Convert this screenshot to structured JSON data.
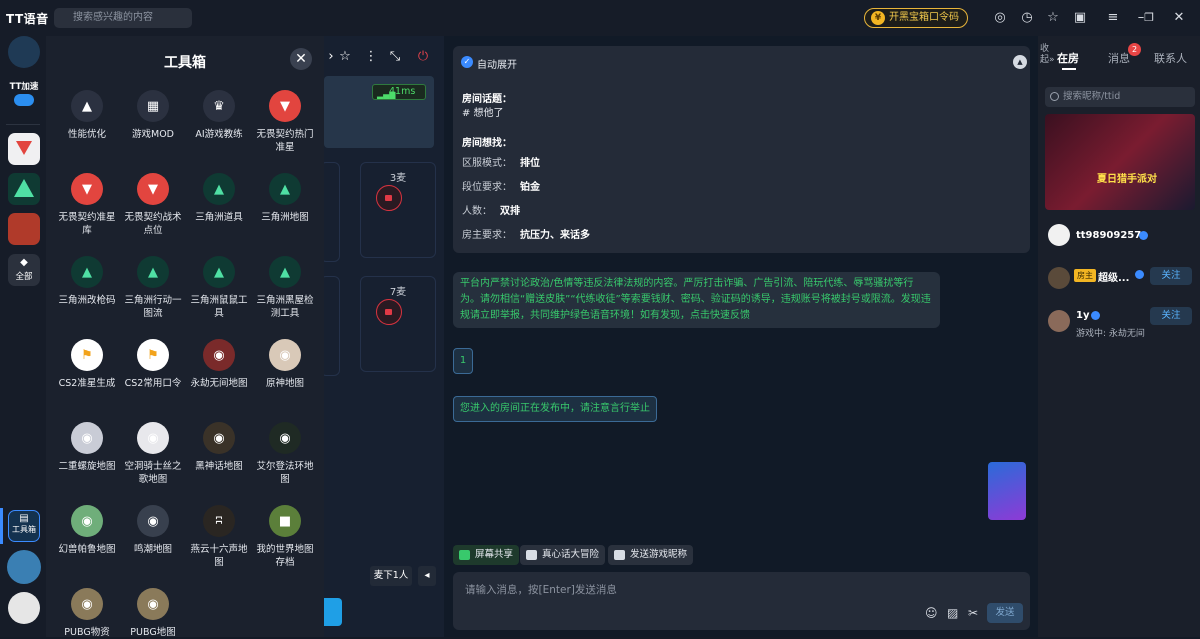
{
  "app": {
    "title": "TT语音"
  },
  "search": {
    "placeholder": "搜索感兴趣的内容"
  },
  "header": {
    "treasure_label": "开黑宝箱口令码"
  },
  "left_rail": {
    "tt_accel_label": "TT加速",
    "all_label": "全部",
    "toolbox_label": "工具箱"
  },
  "toolbox": {
    "title": "工具箱",
    "tools": [
      {
        "label": "性能优化",
        "icon": "rocket-icon",
        "color": "#2b3140"
      },
      {
        "label": "游戏MOD",
        "icon": "grid-icon",
        "color": "#2b3140"
      },
      {
        "label": "AI游戏教练",
        "icon": "ai-coach-icon",
        "color": "#2b3140"
      },
      {
        "label": "无畏契约热门准星",
        "icon": "valorant-icon",
        "color": "#e2453f"
      },
      {
        "label": "无畏契约准星库",
        "icon": "valorant-icon",
        "color": "#e2453f"
      },
      {
        "label": "无畏契约战术点位",
        "icon": "valorant-icon",
        "color": "#e2453f"
      },
      {
        "label": "三角洲道具",
        "icon": "delta-force-icon",
        "color": "#0f3a33"
      },
      {
        "label": "三角洲地图",
        "icon": "delta-force-icon",
        "color": "#0f3a33"
      },
      {
        "label": "三角洲改枪码",
        "icon": "delta-force-icon",
        "color": "#0f3a33"
      },
      {
        "label": "三角洲行动一图流",
        "icon": "delta-force-icon",
        "color": "#0f3a33"
      },
      {
        "label": "三角洲鼠鼠工具",
        "icon": "delta-force-icon",
        "color": "#0f3a33"
      },
      {
        "label": "三角洲黑屋检测工具",
        "icon": "delta-force-icon",
        "color": "#0f3a33"
      },
      {
        "label": "CS2准星生成",
        "icon": "cs2-icon",
        "color": "#ffffff"
      },
      {
        "label": "CS2常用口令",
        "icon": "cs2-icon",
        "color": "#ffffff"
      },
      {
        "label": "永劫无间地图",
        "icon": "naraka-icon",
        "color": "#7a2a2a"
      },
      {
        "label": "原神地图",
        "icon": "genshin-icon",
        "color": "#d9c9b8"
      },
      {
        "label": "二重螺旋地图",
        "icon": "duet-night-icon",
        "color": "#c9ccd6"
      },
      {
        "label": "空洞骑士丝之歌地图",
        "icon": "hollow-knight-icon",
        "color": "#e8e8ec"
      },
      {
        "label": "黑神话地图",
        "icon": "wukong-icon",
        "color": "#3a3228"
      },
      {
        "label": "艾尔登法环地图",
        "icon": "elden-ring-icon",
        "color": "#1f2a24"
      },
      {
        "label": "幻兽帕鲁地图",
        "icon": "palworld-icon",
        "color": "#6fae7a"
      },
      {
        "label": "鸣潮地图",
        "icon": "wuthering-waves-icon",
        "color": "#38404e"
      },
      {
        "label": "燕云十六声地图",
        "icon": "where-winds-meet-icon",
        "color": "#2a2622"
      },
      {
        "label": "我的世界地图存档",
        "icon": "minecraft-icon",
        "color": "#5b7f3a"
      },
      {
        "label": "PUBG物资",
        "icon": "pubg-icon",
        "color": "#8a7a5a"
      },
      {
        "label": "PUBG地图",
        "icon": "pubg-icon",
        "color": "#8a7a5a"
      }
    ]
  },
  "room": {
    "ping": "41ms",
    "slot_a": "3麦",
    "slot_b": "7麦",
    "mic_down": "麦下1人"
  },
  "info_card": {
    "auto_expand": "自动展开",
    "topic_label": "房间话题：",
    "topic_value": "# 想他了",
    "wants_label": "房间想找：",
    "rows": [
      {
        "k": "区服模式：",
        "v": "排位"
      },
      {
        "k": "段位要求：",
        "v": "铂金"
      },
      {
        "k": "人数：",
        "v": "双排"
      },
      {
        "k": "房主要求：",
        "v": "抗压力、来话多"
      }
    ]
  },
  "messages": {
    "warning": "平台内严禁讨论政治/色情等违反法律法规的内容。严厉打击诈骗、广告引流、陪玩代练、辱骂骚扰等行为。请勿相信“赠送皮肤”“代练收徒”等索要钱财、密码、验证码的诱导，违规账号将被封号或限流。发现违规请立即举报，共同维护绿色语音环境！如有发现，点击快速反馈",
    "user_msg": "1",
    "publish_notice": "您进入的房间正在发布中，请注意言行举止"
  },
  "chat_tools": {
    "screen_share": "屏幕共享",
    "truth_dare": "真心话大冒险",
    "send_nickname": "发送游戏昵称"
  },
  "composer": {
    "placeholder": "请输入消息，按[Enter]发送消息",
    "send": "发送"
  },
  "right": {
    "collapse": "收起",
    "tabs": [
      "在房",
      "消息",
      "联系人"
    ],
    "msg_badge": "2",
    "search_placeholder": "搜索昵称/ttid",
    "banner_text": "夏日猎手派对",
    "members": [
      {
        "name": "tt98909257",
        "sub": "",
        "follow": ""
      },
      {
        "name": "超级...",
        "tag": "房主",
        "sub": "",
        "follow": "关注"
      },
      {
        "name": "1y",
        "sub": "游戏中: 永劫无间",
        "follow": "关注"
      }
    ]
  }
}
